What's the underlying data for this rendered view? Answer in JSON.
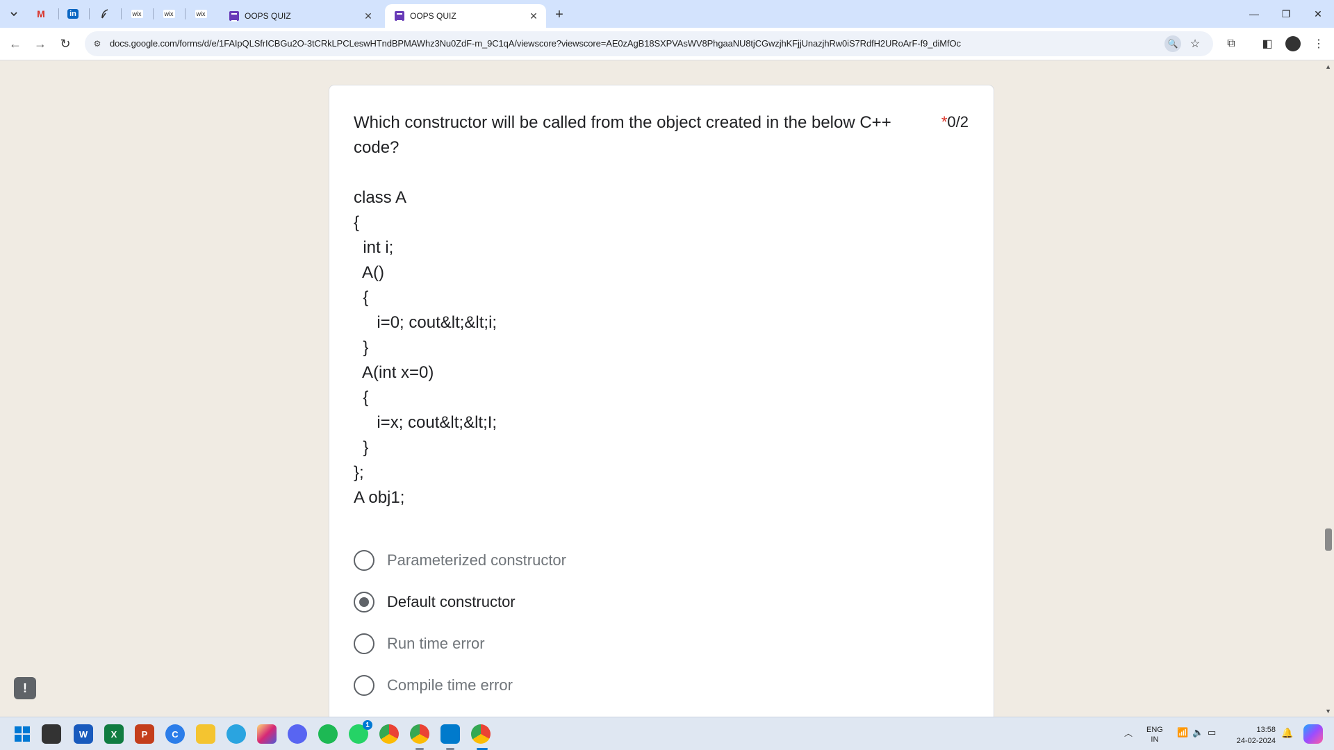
{
  "browser": {
    "pinned_tabs": [
      "gmail-icon",
      "linkedin-icon",
      "feather-icon",
      "wix-icon",
      "wix-icon",
      "wix-icon"
    ],
    "pinned_labels": [
      "M",
      "in",
      "",
      "wix",
      "wix",
      "wix"
    ],
    "tabs": [
      {
        "title": "OOPS QUIZ",
        "active": false
      },
      {
        "title": "OOPS QUIZ",
        "active": true
      }
    ],
    "url": "docs.google.com/forms/d/e/1FAIpQLSfrICBGu2O-3tCRkLPCLeswHTndBPMAWhz3Nu0ZdF-m_9C1qA/viewscore?viewscore=AE0zAgB18SXPVAsWV8PhgaaNU8tjCGwzjhKFjjUnazjhRw0iS7RdfH2URoArF-f9_diMfOc"
  },
  "question": {
    "text": "Which constructor will be called from the object created in the below C++ code?",
    "required_mark": "*",
    "score": "0/2",
    "code_lines": [
      "class A",
      "{",
      "  int i;",
      "  A()",
      "  {",
      "     i=0; cout&lt;&lt;i;",
      "  }",
      "  A(int x=0)",
      "  {",
      "     i=x; cout&lt;&lt;I;",
      "  }",
      "};",
      "A obj1;"
    ],
    "options": [
      {
        "label": "Parameterized constructor",
        "selected": false
      },
      {
        "label": "Default constructor",
        "selected": true
      },
      {
        "label": "Run time error",
        "selected": false
      },
      {
        "label": "Compile time error",
        "selected": false
      }
    ]
  },
  "taskbar": {
    "apps": [
      "windows-start-icon",
      "file-explorer-icon",
      "word-icon",
      "excel-icon",
      "powerpoint-icon",
      "edge-icon",
      "folder-icon",
      "telegram-icon",
      "instagram-icon",
      "discord-icon",
      "spotify-icon",
      "whatsapp-icon",
      "chrome-icon",
      "chrome-profile-icon",
      "vscode-icon",
      "chrome-active-icon"
    ],
    "app_labels": [
      "",
      "",
      "W",
      "X",
      "P",
      "C",
      "",
      "",
      "",
      "",
      "",
      "",
      "",
      "",
      "",
      ""
    ],
    "whatsapp_badge": "1",
    "lang_line1": "ENG",
    "lang_line2": "IN",
    "time": "13:58",
    "date": "24-02-2024"
  },
  "colors": {
    "page_bg": "#f0ebe3",
    "tabstrip_bg": "#d3e3fd",
    "required": "#d93025",
    "forms_purple": "#673ab7"
  }
}
